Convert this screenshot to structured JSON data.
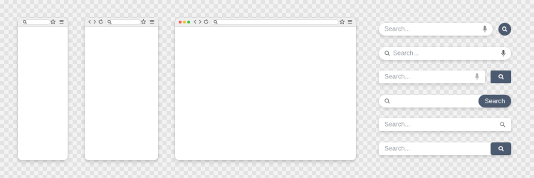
{
  "colors": {
    "background": "#f3f3f3",
    "checker": "#e3e3e3",
    "window_bar": "#efefef",
    "button": "#4c5b70",
    "placeholder": "#9aa0a6",
    "traffic_red": "#f25f58",
    "traffic_yellow": "#fbbe2e",
    "traffic_green": "#3bc840"
  },
  "windows": [
    {
      "name": "mobile",
      "toolbar_icons": [
        "search-icon",
        "star-icon",
        "menu-icon"
      ]
    },
    {
      "name": "tablet",
      "toolbar_icons": [
        "back-icon",
        "forward-icon",
        "reload-icon",
        "search-icon",
        "star-icon",
        "menu-icon"
      ]
    },
    {
      "name": "desktop",
      "toolbar_icons": [
        "close-dot",
        "minimize-dot",
        "maximize-dot",
        "back-icon",
        "forward-icon",
        "reload-icon",
        "search-icon",
        "star-icon",
        "menu-icon"
      ]
    }
  ],
  "search_bars": [
    {
      "style": "rounded-with-mic-and-round-button",
      "placeholder": "Search...",
      "icons": [
        "mic-icon",
        "search-icon"
      ]
    },
    {
      "style": "rounded-icon-left-mic-right",
      "placeholder": "Search...",
      "icons": [
        "search-icon",
        "mic-icon"
      ]
    },
    {
      "style": "square-with-mic-and-square-button",
      "placeholder": "Search...",
      "icons": [
        "mic-icon",
        "search-icon"
      ]
    },
    {
      "style": "rounded-with-text-button",
      "placeholder": "",
      "button_label": "Search",
      "icons": [
        "search-icon"
      ]
    },
    {
      "style": "square-icon-right",
      "placeholder": "Search...",
      "icons": [
        "search-icon"
      ]
    },
    {
      "style": "square-attached-button",
      "placeholder": "Search...",
      "icons": [
        "search-icon"
      ]
    }
  ]
}
